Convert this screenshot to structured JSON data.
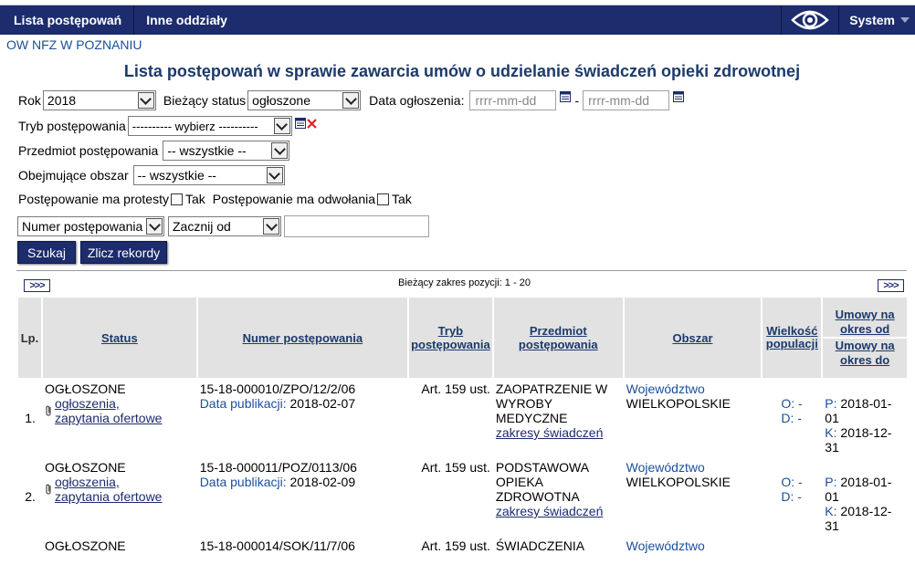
{
  "nav": {
    "list_label": "Lista postępowań",
    "branches_label": "Inne oddziały",
    "eye_icon": "eye-icon",
    "system_label": "System"
  },
  "branch": "OW NFZ W POZNANIU",
  "title": "Lista postępowań w sprawie zawarcia umów o udzielanie świadczeń opieki zdrowotnej",
  "filters": {
    "year_label": "Rok",
    "year_value": "2018",
    "status_label": "Bieżący status",
    "status_value": "ogłoszone",
    "date_label": "Data ogłoszenia:",
    "date_from_placeholder": "rrrr-mm-dd",
    "date_dash": "-",
    "date_to_placeholder": "rrrr-mm-dd",
    "mode_label": "Tryb postępowania",
    "mode_value": "---------- wybierz ----------",
    "subject_label": "Przedmiot postępowania",
    "subject_value": "-- wszystkie --",
    "area_label": "Obejmujące obszar",
    "area_value": "-- wszystkie --",
    "protests_label": "Postępowanie ma protesty",
    "protests_yes": "Tak",
    "appeals_label": "Postępowanie ma odwołania",
    "appeals_yes": "Tak",
    "field_value": "Numer postępowania",
    "match_value": "Zacznij od",
    "search_value": ""
  },
  "buttons": {
    "search": "Szukaj",
    "count": "Zlicz rekordy"
  },
  "pager": {
    "next": ">>>",
    "range": "Bieżący zakres pozycji: 1 - 20"
  },
  "table": {
    "headers": {
      "lp": "Lp.",
      "status": "Status",
      "number": "Numer postępowania",
      "mode": "Tryb postępowania",
      "subject": "Przedmiot postępowania",
      "area": "Obszar",
      "population": "Wielkość populacji",
      "from": "Umowy na okres od",
      "to": "Umowy na okres do"
    },
    "rows": [
      {
        "lp": "1.",
        "status": "OGŁOSZONE",
        "attach": "ogłoszenia, zapytania ofertowe",
        "number": "15-18-000010/ZPO/12/2/06",
        "pub_label": "Data publikacji:",
        "pub_date": "2018-02-07",
        "mode": "Art. 159 ust.",
        "subject": "ZAOPATRZENIE W WYROBY MEDYCZNE",
        "scope": "zakresy świadczeń",
        "area_type": "Województwo",
        "area_name": "WIELKOPOLSKIE",
        "o_label": "O: -",
        "d_label": "D: -",
        "p_label": "P:",
        "p_date": "2018-01-01",
        "k_label": "K:",
        "k_date": "2018-12-31"
      },
      {
        "lp": "2.",
        "status": "OGŁOSZONE",
        "attach": "ogłoszenia, zapytania ofertowe",
        "number": "15-18-000011/POZ/0113/06",
        "pub_label": "Data publikacji:",
        "pub_date": "2018-02-09",
        "mode": "Art. 159 ust.",
        "subject": "PODSTAWOWA OPIEKA ZDROWOTNA",
        "scope": "zakresy świadczeń",
        "area_type": "Województwo",
        "area_name": "WIELKOPOLSKIE",
        "o_label": "O: -",
        "d_label": "D: -",
        "p_label": "P:",
        "p_date": "2018-01-01",
        "k_label": "K:",
        "k_date": "2018-12-31"
      },
      {
        "lp": "",
        "status": "OGŁOSZONE",
        "number": "15-18-000014/SOK/11/7/06",
        "mode": "Art. 159 ust.",
        "subject": "ŚWIADCZENIA",
        "area_type": "Województwo"
      }
    ]
  },
  "colors": {
    "navy": "#1c2c6c",
    "link": "#1a4f9c",
    "header_bg": "#e2e2e2"
  }
}
